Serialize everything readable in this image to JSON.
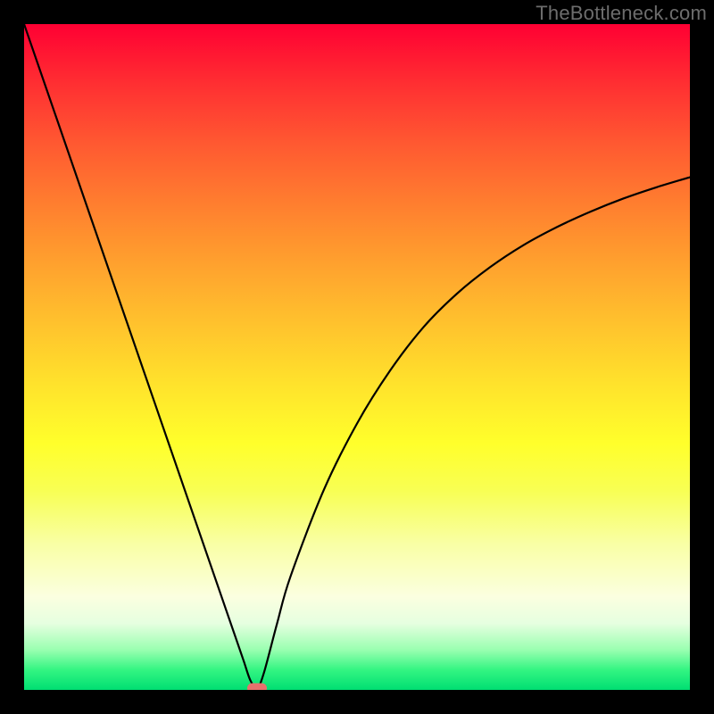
{
  "watermark": "TheBottleneck.com",
  "chart_data": {
    "type": "line",
    "title": "",
    "xlabel": "",
    "ylabel": "",
    "xlim": [
      0,
      100
    ],
    "ylim": [
      0,
      100
    ],
    "grid": false,
    "series": [
      {
        "name": "bottleneck-curve",
        "color": "#000000",
        "x": [
          0,
          5,
          10,
          15,
          20,
          25,
          28,
          30,
          32,
          33,
          34,
          35,
          36,
          38,
          40,
          45,
          50,
          55,
          60,
          65,
          70,
          75,
          80,
          85,
          90,
          95,
          100
        ],
        "y": [
          100,
          85.5,
          71,
          56.5,
          42,
          27.5,
          18.8,
          13,
          7.2,
          4.3,
          1.4,
          0.3,
          2.5,
          10,
          17,
          30,
          40,
          48,
          54.5,
          59.5,
          63.5,
          66.8,
          69.5,
          71.8,
          73.8,
          75.5,
          77
        ]
      }
    ],
    "minimum_marker": {
      "x": 35,
      "y": 0.3,
      "color": "#e8716d"
    },
    "background_gradient": {
      "orientation": "vertical",
      "stops": [
        {
          "pos": 0,
          "color": "#ff0033"
        },
        {
          "pos": 50,
          "color": "#ffd12c"
        },
        {
          "pos": 78,
          "color": "#f9ffa4"
        },
        {
          "pos": 100,
          "color": "#00de72"
        }
      ]
    }
  }
}
